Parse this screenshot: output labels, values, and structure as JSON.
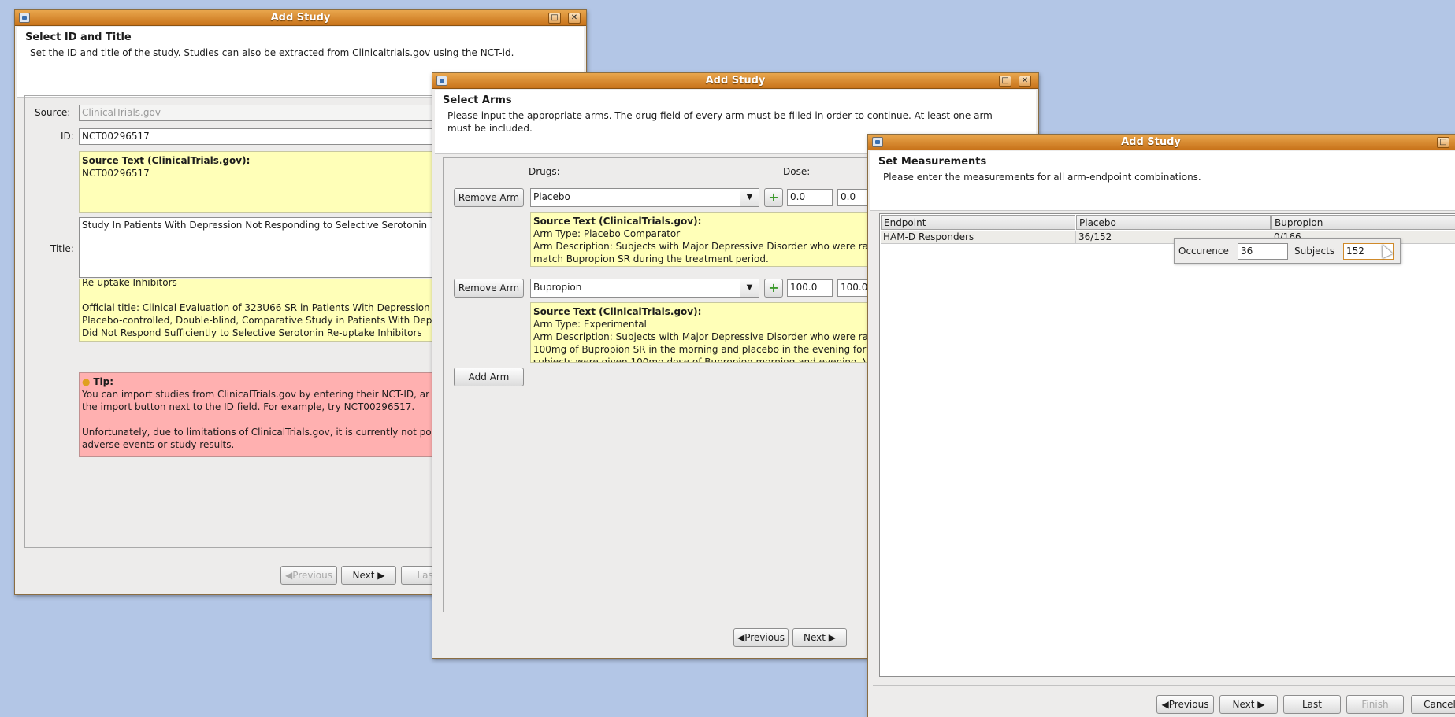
{
  "window1": {
    "title": "Add Study",
    "header_title": "Select ID and Title",
    "header_desc": "Set the ID and title of the study. Studies can also be extracted from Clinicaltrials.gov using the NCT-id.",
    "source_label": "Source:",
    "source_value": "ClinicalTrials.gov",
    "id_label": "ID:",
    "id_value": "NCT00296517",
    "src_text_title": "Source Text (ClinicalTrials.gov):",
    "src_text_value": "NCT00296517",
    "title_label": "Title:",
    "title_value": "Study In Patients With Depression Not Responding to Selective Serotonin",
    "title_src_line1": "Re-uptake Inhibitors",
    "title_src_line2": "Official title: Clinical Evaluation of 323U66 SR in Patients With Depression",
    "title_src_line3": "Placebo-controlled, Double-blind, Comparative Study in Patients With Dep",
    "title_src_line4": "Did Not Respond Sufficiently to Selective Serotonin Re-uptake Inhibitors",
    "tip_title": "Tip:",
    "tip_line1": "You can import studies from ClinicalTrials.gov by entering their NCT-ID, ar",
    "tip_line2": "the import button next to the ID field. For example, try NCT00296517.",
    "tip_line3": "Unfortunately, due to limitations of ClinicalTrials.gov, it is currently not po",
    "tip_line4": "adverse events or study results.",
    "prev_label": "Previous",
    "next_label": "Next",
    "last_label": "Last"
  },
  "window2": {
    "title": "Add Study",
    "header_title": "Select Arms",
    "header_desc1": "Please input the appropriate arms. The drug field of every arm must be filled in order to continue. At least one arm",
    "header_desc2": "must be included.",
    "drugs_label": "Drugs:",
    "dose_label": "Dose:",
    "arms": [
      {
        "remove_label": "Remove Arm",
        "drug": "Placebo",
        "dose_min": "0.0",
        "dose_max": "0.0",
        "src_title": "Source Text (ClinicalTrials.gov):",
        "src_line1": "Arm Type: Placebo Comparator",
        "src_line2": "Arm Description: Subjects with Major Depressive Disorder who were ra",
        "src_line3": "match Bupropion SR during the treatment period."
      },
      {
        "remove_label": "Remove Arm",
        "drug": "Bupropion",
        "dose_min": "100.0",
        "dose_max": "100.0",
        "src_title": "Source Text (ClinicalTrials.gov):",
        "src_line1": "Arm Type: Experimental",
        "src_line2": "Arm Description: Subjects with Major Depressive Disorder who were ra",
        "src_line3": "100mg of Bupropion SR in the morning and placebo in the evening for",
        "src_line4": "subjects were given 100mg dose of Bupropion morning and evening. V"
      }
    ],
    "add_arm_label": "Add Arm",
    "prev_label": "Previous",
    "next_label": "Next"
  },
  "window3": {
    "title": "Add Study",
    "header_title": "Set Measurements",
    "header_desc": "Please enter the measurements for all arm-endpoint combinations.",
    "table": {
      "headers": [
        "Endpoint",
        "Placebo",
        "Bupropion"
      ],
      "rows": [
        [
          "HAM-D Responders",
          "36/152",
          "0/166"
        ]
      ]
    },
    "editor": {
      "occurence_label": "Occurence",
      "occurence_value": "36",
      "subjects_label": "Subjects",
      "subjects_value": "152"
    },
    "prev_label": "Previous",
    "next_label": "Next",
    "last_label": "Last",
    "finish_label": "Finish",
    "cancel_label": "Cancel"
  }
}
